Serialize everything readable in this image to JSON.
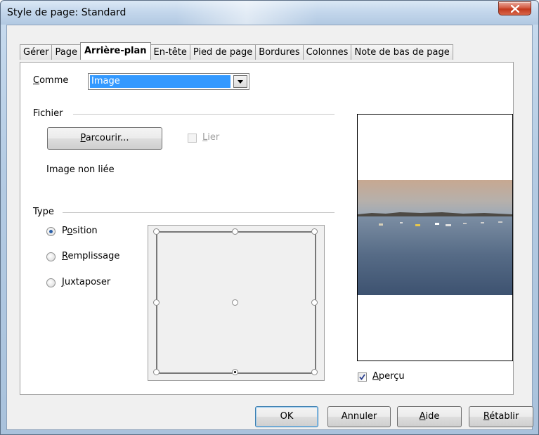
{
  "window": {
    "title": "Style de page: Standard"
  },
  "tabs": [
    {
      "label": "Gérer",
      "active": false
    },
    {
      "label": "Page",
      "active": false
    },
    {
      "label": "Arrière-plan",
      "active": true
    },
    {
      "label": "En-tête",
      "active": false
    },
    {
      "label": "Pied de page",
      "active": false
    },
    {
      "label": "Bordures",
      "active": false
    },
    {
      "label": "Colonnes",
      "active": false
    },
    {
      "label": "Note de bas de page",
      "active": false
    }
  ],
  "as": {
    "label_underlined": "C",
    "label_rest": "omme",
    "selected": "Image"
  },
  "file_group": {
    "title": "Fichier",
    "browse_underlined": "P",
    "browse_rest": "arcourir...",
    "link_underlined": "L",
    "link_rest": "ier",
    "link_checked": false,
    "status": "Image non liée"
  },
  "type_group": {
    "title": "Type",
    "options": [
      {
        "underlined": "",
        "pre": "P",
        "u": "o",
        "post": "sition",
        "selected": true
      },
      {
        "pre": "",
        "u": "R",
        "post": "emplissage",
        "selected": false
      },
      {
        "pre": "",
        "u": "J",
        "post": "uxtaposer",
        "selected": false
      }
    ],
    "selected_position": "bottom-center"
  },
  "preview": {
    "check_underlined": "A",
    "check_rest": "perçu",
    "checked": true
  },
  "buttons": {
    "ok": "OK",
    "cancel": "Annuler",
    "help_underlined": "A",
    "help_rest": "ide",
    "reset_underlined": "R",
    "reset_rest": "établir"
  },
  "colors": {
    "selection": "#3399ff",
    "radio_dot": "#2a5fa8",
    "close_button": "#c2391e"
  },
  "icons": [
    "close-icon",
    "dropdown-arrow-icon",
    "checkmark-icon",
    "landscape-preview-image"
  ]
}
